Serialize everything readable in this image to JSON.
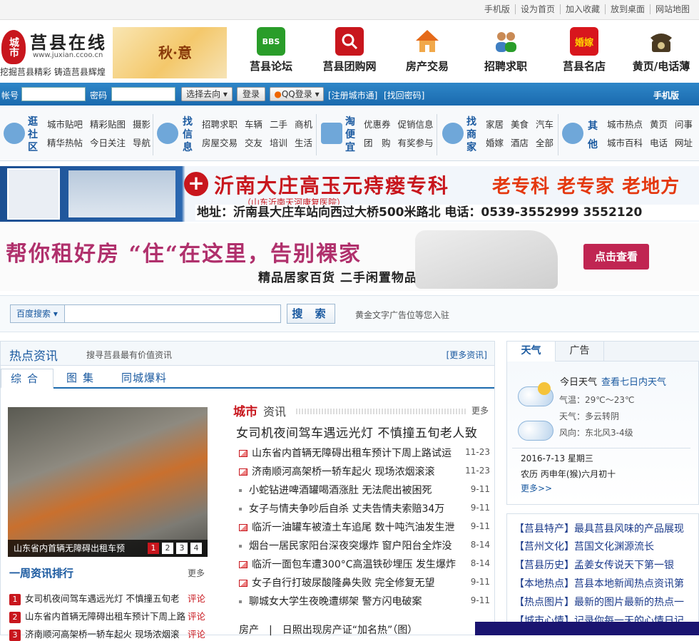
{
  "topbar": {
    "links": [
      "手机版",
      "设为首页",
      "加入收藏",
      "放到桌面",
      "网站地图"
    ]
  },
  "header": {
    "logo_badge": "城市",
    "logo_title": "莒县在线",
    "logo_url": "www.juxian.ccoo.cn",
    "slogan": "挖掘莒县精彩  铸造莒县辉煌",
    "season_text": "秋·意"
  },
  "nav": [
    {
      "label": "莒县论坛",
      "icon": "bbs-icon",
      "badge": "BBS",
      "color": "#2a9d2a"
    },
    {
      "label": "莒县团购网",
      "icon": "magnifier-icon",
      "badge": "",
      "color": "#c8161d"
    },
    {
      "label": "房产交易",
      "icon": "house-icon",
      "badge": "",
      "color": "#e56a1a"
    },
    {
      "label": "招聘求职",
      "icon": "people-icon",
      "badge": "",
      "color": "#3f7fc2"
    },
    {
      "label": "莒县名店",
      "icon": "wedding-icon",
      "badge": "婚嫁",
      "color": "#d8161d"
    },
    {
      "label": "黄页/电话薄",
      "icon": "telephone-icon",
      "badge": "",
      "color": "#4a3a22"
    }
  ],
  "login": {
    "account_label": "帐号",
    "password_label": "密码",
    "select_label": "选择去向",
    "login_button": "登录",
    "qq_login": "QQ登录",
    "register": "[注册城市通]",
    "forgot": "[找回密码]",
    "mobile": "手机版"
  },
  "categories": [
    {
      "head": "逛社区",
      "rows": [
        [
          "城市贴吧",
          "精彩贴图",
          "摄影"
        ],
        [
          "精华热帖",
          "今日关注",
          "导航"
        ]
      ]
    },
    {
      "head": "找信息",
      "rows": [
        [
          "招聘求职",
          "车辆",
          "二手",
          "商机"
        ],
        [
          "房屋交易",
          "交友",
          "培训",
          "生活"
        ]
      ]
    },
    {
      "head": "淘便宜",
      "rows": [
        [
          "优惠券",
          "促销信息"
        ],
        [
          "团　购",
          "有奖参与"
        ]
      ]
    },
    {
      "head": "找商家",
      "rows": [
        [
          "家居",
          "美食",
          "汽车"
        ],
        [
          "婚嫁",
          "酒店",
          "全部"
        ]
      ]
    },
    {
      "head": "其他",
      "rows": [
        [
          "城市热点",
          "黄页",
          "问事"
        ],
        [
          "城市百科",
          "电话",
          "网址"
        ]
      ]
    }
  ],
  "ad1": {
    "title": "沂南大庄高玉元痔瘘专科",
    "subtitle": "（山东沂南天河康复医院）",
    "slogan": "老专科 老专家 老地方",
    "address": "地址：沂南县大庄车站向西过大桥500米路北   电话：0539-3552999   3552120"
  },
  "ad2": {
    "title": "帮你租好房 “住“在这里，告别裸家",
    "subtitle": "精品居家百货  二手闲置物品",
    "button": "点击查看"
  },
  "search": {
    "select_label": "百度搜索",
    "button": "搜 索",
    "ad_text": "黄金文字广告位等您入驻"
  },
  "hot": {
    "title": "热点资讯",
    "subtitle": "搜寻莒县最有价值资讯",
    "more": "[更多资讯]",
    "tabs": [
      "综合",
      "图集",
      "同城爆料"
    ],
    "photo_caption": "山东省内首辆无障碍出租车预",
    "pager": [
      "1",
      "2",
      "3",
      "4"
    ],
    "week_title": "一周资讯排行",
    "week_more": "更多",
    "rank": [
      {
        "n": "1",
        "title": "女司机夜间驾车遇远光灯 不慎撞五旬老",
        "cmt": "评论"
      },
      {
        "n": "2",
        "title": "山东省内首辆无障碍出租车预计下周上路",
        "cmt": "评论"
      },
      {
        "n": "3",
        "title": "济南顺河高架桥一轿车起火 现场浓烟滚",
        "cmt": "评论"
      }
    ]
  },
  "city": {
    "title_a": "城市",
    "title_b": "资讯",
    "more": "更多",
    "headline": "女司机夜间驾车遇远光灯 不慎撞五旬老人致",
    "items": [
      {
        "title": "山东省内首辆无障碍出租车预计下周上路试运",
        "date": "11-23",
        "pic": true
      },
      {
        "title": "济南顺河高架桥一轿车起火 现场浓烟滚滚",
        "date": "11-23",
        "pic": true
      },
      {
        "title": "小蛇钻进啤酒罐喝酒涨肚 无法爬出被困死",
        "date": "9-11",
        "pic": false
      },
      {
        "title": "女子与情夫争吵后自杀 丈夫告情夫索赔34万",
        "date": "9-11",
        "pic": false
      },
      {
        "title": "临沂一油罐车被渣土车追尾 数十吨汽油发生泄",
        "date": "9-11",
        "pic": true
      },
      {
        "title": "烟台一居民家阳台深夜突爆炸 窗户阳台全炸没",
        "date": "8-14",
        "pic": false
      },
      {
        "title": "临沂一面包车遭300°C高温铁砂埋压 发生爆炸",
        "date": "8-14",
        "pic": true
      },
      {
        "title": "女子自行打玻尿酸隆鼻失败 完全修复无望",
        "date": "9-11",
        "pic": true
      },
      {
        "title": "聊城女大学生夜晚遭绑架 警方闪电破案",
        "date": "9-11",
        "pic": false
      }
    ],
    "house_label": "房产",
    "house_text": "日照出现房产证“加名热”（图）"
  },
  "weather": {
    "tab_weather": "天气",
    "tab_ad": "广告",
    "today": "今日天气",
    "week": "查看七日内天气",
    "temp": "气温：29℃～23℃",
    "cond": "天气：多云转阴",
    "wind": "风向：东北风3-4级",
    "date": "2016-7-13 星期三",
    "lunar": "农历 丙申年(猴)六月初十",
    "more": "更多>>"
  },
  "right_links": [
    {
      "tag": "【莒县特产】",
      "text": "最具莒县风味的产品展现"
    },
    {
      "tag": "【莒州文化】",
      "text": "莒国文化渊源流长"
    },
    {
      "tag": "【莒县历史】",
      "text": "孟姜女传说天下第一银"
    },
    {
      "tag": "【本地热点】",
      "text": "莒县本地新闻热点资讯第"
    },
    {
      "tag": "【热点图片】",
      "text": "最新的图片最新的热点一"
    },
    {
      "tag": "【城市心情】",
      "text": "记录你每一天的心情日记"
    }
  ]
}
